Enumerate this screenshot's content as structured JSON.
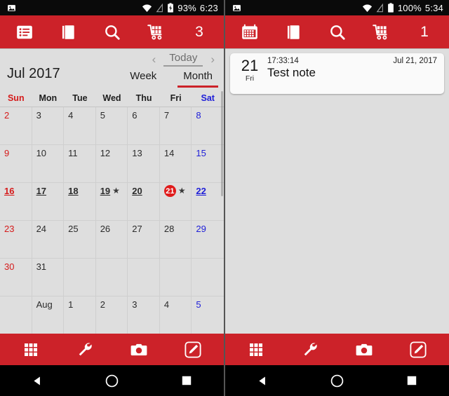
{
  "left": {
    "status": {
      "notification_icon": "image-icon",
      "wifi_icon": "wifi-icon",
      "signal_icon": "signal-off-icon",
      "battery_icon": "battery-charging-icon",
      "battery": "93%",
      "time": "6:23"
    },
    "appbar": {
      "items": [
        {
          "name": "list-icon",
          "label": ""
        },
        {
          "name": "book-icon",
          "label": ""
        },
        {
          "name": "search-icon",
          "label": ""
        },
        {
          "name": "cart-icon",
          "label": ""
        }
      ],
      "count": "3"
    },
    "calendar": {
      "title": "Jul 2017",
      "prev_label": "‹",
      "next_label": "›",
      "today_label": "Today",
      "tabs": [
        {
          "label": "Week",
          "active": false
        },
        {
          "label": "Month",
          "active": true
        }
      ],
      "weekdays": [
        "Sun",
        "Mon",
        "Tue",
        "Wed",
        "Thu",
        "Fri",
        "Sat"
      ],
      "weeks": [
        [
          {
            "label": "2",
            "kind": "sun"
          },
          {
            "label": "3",
            "kind": "day"
          },
          {
            "label": "4",
            "kind": "day"
          },
          {
            "label": "5",
            "kind": "day"
          },
          {
            "label": "6",
            "kind": "day"
          },
          {
            "label": "7",
            "kind": "day"
          },
          {
            "label": "8",
            "kind": "sat"
          }
        ],
        [
          {
            "label": "9",
            "kind": "sun"
          },
          {
            "label": "10",
            "kind": "day"
          },
          {
            "label": "11",
            "kind": "day"
          },
          {
            "label": "12",
            "kind": "day"
          },
          {
            "label": "13",
            "kind": "day"
          },
          {
            "label": "14",
            "kind": "day"
          },
          {
            "label": "15",
            "kind": "sat"
          }
        ],
        [
          {
            "label": "16",
            "kind": "sun",
            "underline": true
          },
          {
            "label": "17",
            "kind": "day",
            "underline": true
          },
          {
            "label": "18",
            "kind": "day",
            "underline": true
          },
          {
            "label": "19",
            "kind": "day",
            "underline": true,
            "star": true
          },
          {
            "label": "20",
            "kind": "day",
            "underline": true
          },
          {
            "label": "21",
            "kind": "today",
            "underline": true,
            "star": true
          },
          {
            "label": "22",
            "kind": "sat",
            "underline": true
          }
        ],
        [
          {
            "label": "23",
            "kind": "sun"
          },
          {
            "label": "24",
            "kind": "day"
          },
          {
            "label": "25",
            "kind": "day"
          },
          {
            "label": "26",
            "kind": "day"
          },
          {
            "label": "27",
            "kind": "day"
          },
          {
            "label": "28",
            "kind": "day"
          },
          {
            "label": "29",
            "kind": "sat"
          }
        ],
        [
          {
            "label": "30",
            "kind": "sun"
          },
          {
            "label": "31",
            "kind": "day"
          },
          {
            "label": "",
            "kind": "day"
          },
          {
            "label": "",
            "kind": "day"
          },
          {
            "label": "",
            "kind": "day"
          },
          {
            "label": "",
            "kind": "day"
          },
          {
            "label": "",
            "kind": "sat"
          }
        ],
        [
          {
            "label": "",
            "kind": "sun"
          },
          {
            "label": "Aug",
            "kind": "day"
          },
          {
            "label": "1",
            "kind": "day"
          },
          {
            "label": "2",
            "kind": "day"
          },
          {
            "label": "3",
            "kind": "day"
          },
          {
            "label": "4",
            "kind": "day"
          },
          {
            "label": "5",
            "kind": "sat"
          }
        ]
      ]
    },
    "bottombar": {
      "items": [
        {
          "name": "grid-icon"
        },
        {
          "name": "wrench-icon"
        },
        {
          "name": "camera-icon"
        },
        {
          "name": "edit-pencil-icon"
        }
      ]
    },
    "navbar": {
      "back": "back-triangle-icon",
      "home": "home-circle-icon",
      "recents": "recents-square-icon"
    }
  },
  "right": {
    "status": {
      "notification_icon": "image-icon",
      "wifi_icon": "wifi-icon",
      "signal_icon": "signal-off-icon",
      "battery_icon": "battery-full-icon",
      "battery": "100%",
      "time": "5:34"
    },
    "appbar": {
      "items": [
        {
          "name": "calendar-icon",
          "label": ""
        },
        {
          "name": "book-icon",
          "label": ""
        },
        {
          "name": "search-icon",
          "label": ""
        },
        {
          "name": "cart-icon",
          "label": ""
        }
      ],
      "count": "1"
    },
    "notes": [
      {
        "day": "21",
        "weekday": "Fri",
        "time": "17:33:14",
        "date": "Jul 21, 2017",
        "title": "Test note"
      }
    ],
    "bottombar": {
      "items": [
        {
          "name": "grid-icon"
        },
        {
          "name": "wrench-icon"
        },
        {
          "name": "camera-icon"
        },
        {
          "name": "edit-pencil-icon"
        }
      ]
    },
    "navbar": {
      "back": "back-triangle-icon",
      "home": "home-circle-icon",
      "recents": "recents-square-icon"
    }
  },
  "theme": {
    "accent": "#cc2229",
    "today_red": "#e01b1b",
    "sunday_red": "#d51b1b",
    "saturday_blue": "#2020d8",
    "bg_gray": "#dedede"
  }
}
